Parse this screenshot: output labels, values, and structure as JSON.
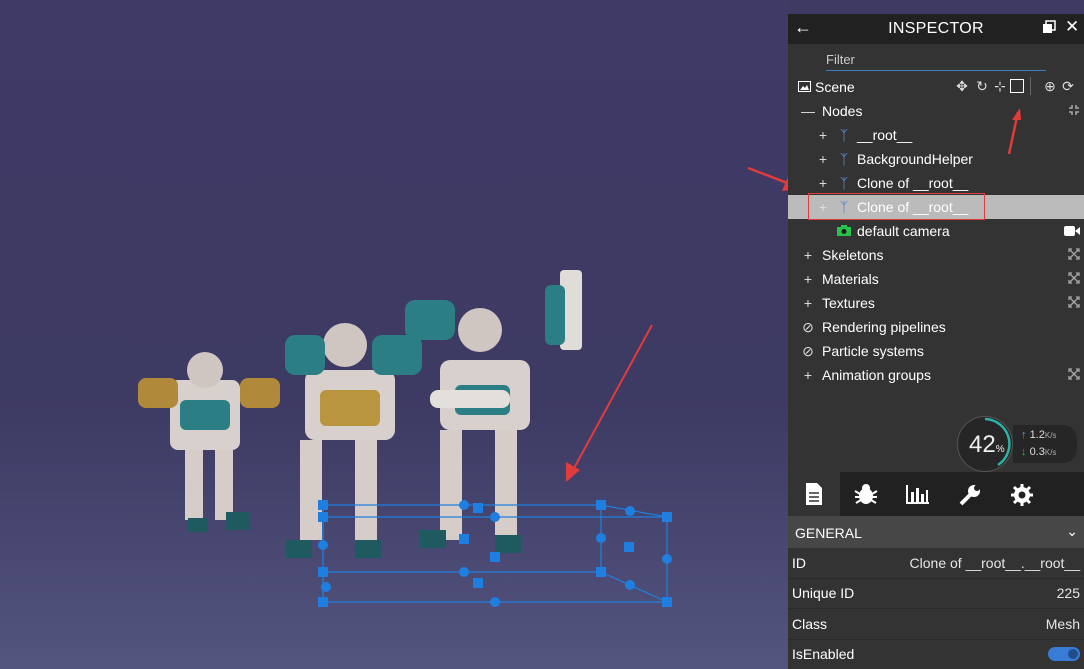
{
  "inspector": {
    "title": "INSPECTOR",
    "filter_label": "Filter",
    "scene_label": "Scene",
    "tree": {
      "nodes_label": "Nodes",
      "node_items": [
        "__root__",
        "BackgroundHelper",
        "Clone of __root__",
        "Clone of __root__"
      ],
      "camera_label": "default camera",
      "groups": [
        "Skeletons",
        "Materials",
        "Textures",
        "Rendering pipelines",
        "Particle systems",
        "Animation groups"
      ]
    },
    "perf": {
      "fps_percent": "42",
      "pct_unit": "%",
      "upload": "1.2",
      "download": "0.3",
      "rate_unit": "K/s"
    },
    "section_title": "GENERAL",
    "props": [
      {
        "key": "ID",
        "value": "Clone of __root__.__root__"
      },
      {
        "key": "Unique ID",
        "value": "225"
      },
      {
        "key": "Class",
        "value": "Mesh"
      },
      {
        "key": "IsEnabled",
        "value": ""
      }
    ],
    "is_enabled": true
  },
  "colors": {
    "accent": "#1f7fe0",
    "selection": "#bbbbbb",
    "arrow": "#e23b3b"
  }
}
